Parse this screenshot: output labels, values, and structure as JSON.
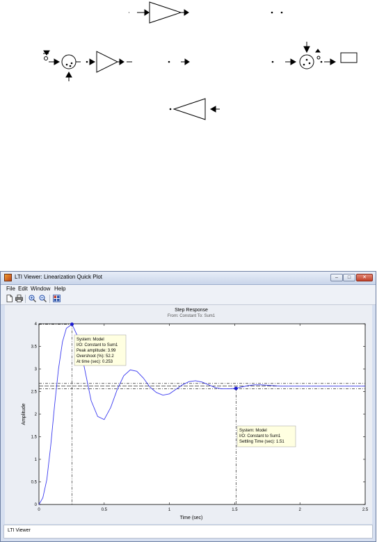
{
  "window": {
    "title": "LTI Viewer: Linearization Quick Plot",
    "controls": {
      "minimize": "–",
      "maximize": "□",
      "close": "✕"
    }
  },
  "menu": {
    "file": "File",
    "edit": "Edit",
    "window": "Window",
    "help": "Help"
  },
  "toolbar": {
    "icons": [
      "new-document-icon",
      "print-icon",
      "zoom-in-icon",
      "zoom-out-icon",
      "plot-config-icon"
    ]
  },
  "plot": {
    "title": "Step Response",
    "subtitle": "From: Constant  To: Sum1",
    "xlabel": "Time (sec)",
    "ylabel": "Amplitude"
  },
  "datatip_peak": {
    "system": "System: Model",
    "io": "I/O: Constant to Sum1",
    "peak": "Peak amplitude: 3.99",
    "overshoot": "Overshoot (%): 52.2",
    "time": "At time (sec): 0.253"
  },
  "datatip_settling": {
    "system": "System: Model",
    "io": "I/O: Constant to Sum1",
    "settling": "Settling Time (sec): 1.51"
  },
  "status": {
    "text": "LTI Viewer"
  },
  "colors": {
    "response": "#3a3af0",
    "marker": "#1a1ad0",
    "tip_bg": "#ffffe1"
  },
  "chart_data": {
    "type": "line",
    "title": "Step Response",
    "subtitle": "From: Constant  To: Sum1",
    "xlabel": "Time (sec)",
    "ylabel": "Amplitude",
    "xlim": [
      0,
      2.5
    ],
    "ylim": [
      0,
      4
    ],
    "xticks": [
      "0",
      "0.5",
      "1",
      "1.5",
      "2",
      "2.5"
    ],
    "yticks": [
      "0",
      "0.5",
      "1",
      "1.5",
      "2",
      "2.5",
      "3",
      "3.5",
      "4"
    ],
    "grid": false,
    "series": [
      {
        "x": [
          0,
          0.03,
          0.06,
          0.09,
          0.12,
          0.15,
          0.18,
          0.21,
          0.253,
          0.3,
          0.35,
          0.4,
          0.45,
          0.5,
          0.55,
          0.6,
          0.65,
          0.7,
          0.75,
          0.8,
          0.85,
          0.9,
          0.95,
          1.0,
          1.05,
          1.1,
          1.15,
          1.2,
          1.25,
          1.3,
          1.35,
          1.4,
          1.45,
          1.51,
          1.55,
          1.6,
          1.65,
          1.7,
          1.75,
          1.8,
          1.85,
          1.9,
          2.0,
          2.1,
          2.2,
          2.3,
          2.4,
          2.5
        ],
        "y": [
          0,
          0.15,
          0.55,
          1.3,
          2.2,
          3.0,
          3.6,
          3.9,
          3.99,
          3.7,
          3.0,
          2.3,
          1.95,
          1.88,
          2.15,
          2.55,
          2.85,
          2.98,
          2.95,
          2.8,
          2.6,
          2.48,
          2.42,
          2.45,
          2.55,
          2.65,
          2.72,
          2.74,
          2.71,
          2.65,
          2.59,
          2.56,
          2.56,
          2.57,
          2.6,
          2.63,
          2.65,
          2.65,
          2.64,
          2.63,
          2.62,
          2.62,
          2.62,
          2.62,
          2.62,
          2.62,
          2.62,
          2.62
        ]
      }
    ],
    "settling_band": [
      2.56,
      2.68
    ],
    "final_value": 2.62,
    "peak": {
      "x": 0.253,
      "y": 3.99
    },
    "settling_point": {
      "x": 1.51,
      "y": 2.57
    }
  }
}
